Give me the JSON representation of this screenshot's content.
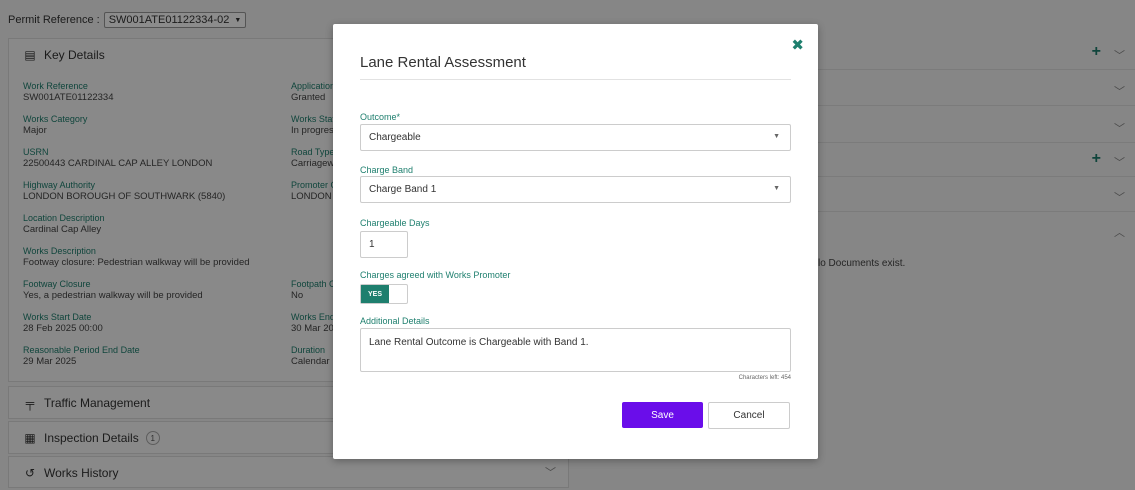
{
  "permit": {
    "label": "Permit Reference :",
    "value": "SW001ATE01122334-02"
  },
  "key_details": {
    "title": "Key Details",
    "left_fields": [
      {
        "label": "Work Reference",
        "value": "SW001ATE01122334"
      },
      {
        "label": "Works Category",
        "value": "Major"
      },
      {
        "label": "USRN",
        "value": "22500443 CARDINAL CAP ALLEY LONDON"
      },
      {
        "label": "Highway Authority",
        "value": "LONDON BOROUGH OF SOUTHWARK (5840)"
      },
      {
        "label": "Location Description",
        "value": "Cardinal Cap Alley"
      },
      {
        "label": "Works Description",
        "value": "Footway closure: Pedestrian walkway will be provided"
      },
      {
        "label": "Footway Closure",
        "value": "Yes, a pedestrian walkway will be provided"
      },
      {
        "label": "Works Start Date",
        "value": "28 Feb 2025 00:00"
      },
      {
        "label": "Reasonable Period End Date",
        "value": "29 Mar 2025"
      }
    ],
    "right_fields": [
      {
        "label": "Application",
        "value": "Granted"
      },
      {
        "label": "Works Stat",
        "value": "In progres"
      },
      {
        "label": "Road Type",
        "value": "Carriagew"
      },
      {
        "label": "Promoter C",
        "value": "LONDON"
      },
      {
        "label": "Footpath C",
        "value": "No"
      },
      {
        "label": "Works End",
        "value": "30 Mar 20"
      },
      {
        "label": "Duration",
        "value": "Calendar"
      }
    ]
  },
  "sections": {
    "traffic": "Traffic Management",
    "inspection": "Inspection Details",
    "inspection_count": "1",
    "history": "Works History"
  },
  "documents": {
    "empty_text": "lo Documents exist."
  },
  "modal": {
    "title": "Lane Rental Assessment",
    "outcome_label": "Outcome*",
    "outcome_value": "Chargeable",
    "band_label": "Charge Band",
    "band_value": "Charge Band 1",
    "days_label": "Chargeable Days",
    "days_value": "1",
    "agreed_label": "Charges agreed with Works Promoter",
    "agreed_toggle": "YES",
    "details_label": "Additional Details",
    "details_value": "Lane Rental Outcome is Chargeable with Band 1.",
    "chars_left": "Characters left: 454",
    "save": "Save",
    "cancel": "Cancel"
  },
  "colors": {
    "accent": "#1e7f6e",
    "primary_button": "#6a0dea"
  }
}
